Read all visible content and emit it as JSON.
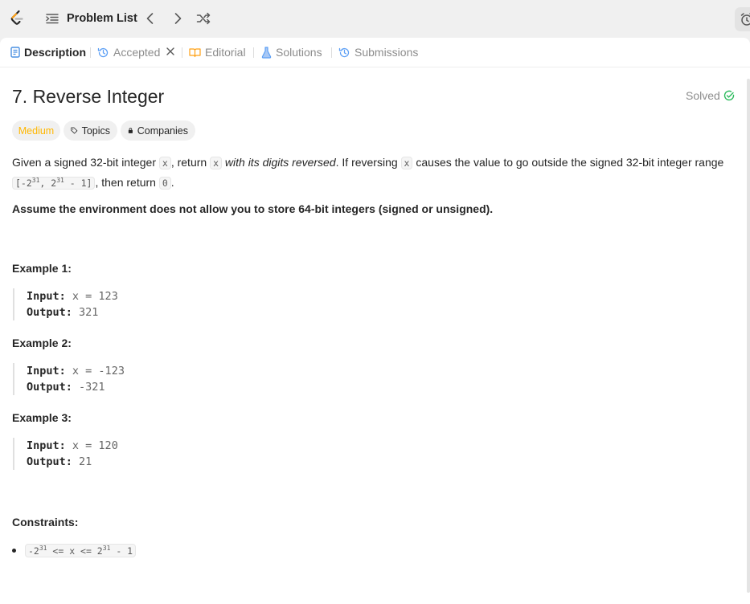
{
  "topbar": {
    "problem_list_label": "Problem List"
  },
  "tabs": [
    {
      "label": "Description"
    },
    {
      "label": "Accepted"
    },
    {
      "label": "Editorial"
    },
    {
      "label": "Solutions"
    },
    {
      "label": "Submissions"
    }
  ],
  "problem": {
    "title": "7. Reverse Integer",
    "status": "Solved",
    "difficulty": "Medium",
    "topics_label": "Topics",
    "companies_label": "Companies",
    "desc": {
      "p1_a": "Given a signed 32-bit integer ",
      "p1_x1": "x",
      "p1_b": ", return ",
      "p1_x2": "x",
      "p1_c": " with its digits reversed",
      "p1_d": ". If reversing ",
      "p1_x3": "x",
      "p1_e": " causes the value to go outside the signed 32-bit integer range",
      "range_a": "[-2",
      "range_exp1": "31",
      "range_b": ", 2",
      "range_exp2": "31",
      "range_c": " - 1]",
      "p1_f": ", then return ",
      "p1_zero": "0",
      "p1_g": ".",
      "p2": "Assume the environment does not allow you to store 64-bit integers (signed or unsigned)."
    },
    "examples": [
      {
        "title": "Example 1:",
        "input_label": "Input:",
        "input": "x = 123",
        "output_label": "Output:",
        "output": "321"
      },
      {
        "title": "Example 2:",
        "input_label": "Input:",
        "input": "x = -123",
        "output_label": "Output:",
        "output": "-321"
      },
      {
        "title": "Example 3:",
        "input_label": "Input:",
        "input": "x = 120",
        "output_label": "Output:",
        "output": "21"
      }
    ],
    "constraints_title": "Constraints:",
    "constraint": {
      "a": "-2",
      "exp1": "31",
      "b": " <= x <= 2",
      "exp2": "31",
      "c": " - 1"
    }
  },
  "colors": {
    "medium": "#ffb700",
    "solved": "#2cbb5d",
    "tab_icon_blue": "#5c9ff5",
    "editorial_icon": "#ffa116"
  }
}
